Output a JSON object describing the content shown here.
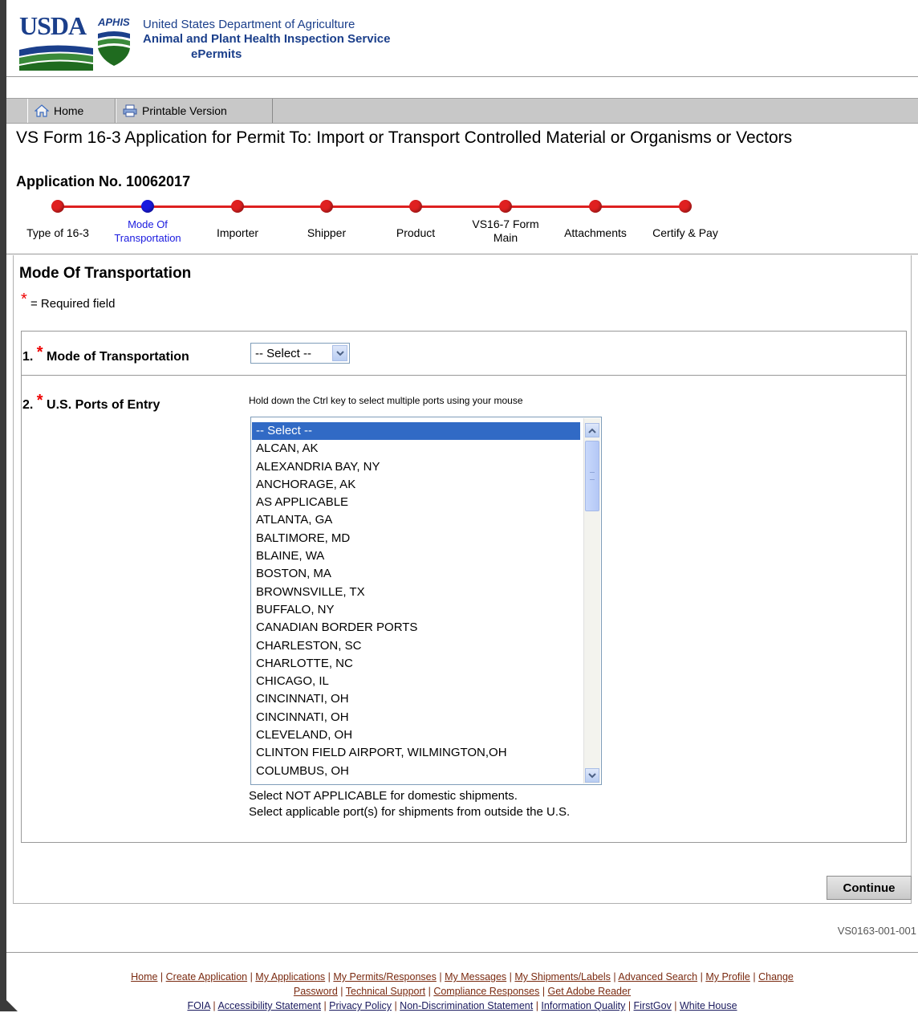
{
  "header": {
    "usda": "USDA",
    "aphis": "APHIS",
    "org_line1": "United States Department of Agriculture",
    "org_line2": "Animal and Plant Health Inspection Service",
    "org_line3": "ePermits"
  },
  "toolbar": {
    "home_label": "Home",
    "print_label": "Printable Version"
  },
  "form": {
    "title": "VS Form 16-3 Application for Permit To: Import or Transport Controlled Material or Organisms or Vectors",
    "application_no": "Application No. 10062017"
  },
  "progress": {
    "steps": [
      {
        "label": "Type of 16-3",
        "current": false
      },
      {
        "label": "Mode Of Transportation",
        "current": true
      },
      {
        "label": "Importer",
        "current": false
      },
      {
        "label": "Shipper",
        "current": false
      },
      {
        "label": "Product",
        "current": false
      },
      {
        "label": "VS16-7 Form Main",
        "current": false
      },
      {
        "label": "Attachments",
        "current": false
      },
      {
        "label": "Certify & Pay",
        "current": false
      }
    ]
  },
  "section": {
    "title": "Mode Of Transportation",
    "required_star": "*",
    "required_note": "= Required field"
  },
  "fields": {
    "q1_number": "1.",
    "q1_label": "Mode of Transportation",
    "q1_value": "-- Select --",
    "q2_number": "2.",
    "q2_label": "U.S. Ports of Entry",
    "ctrl_hint": "Hold down the Ctrl key to select multiple ports using your mouse",
    "ports": [
      "-- Select --",
      "ALCAN, AK",
      "ALEXANDRIA BAY, NY",
      "ANCHORAGE, AK",
      "AS APPLICABLE",
      "ATLANTA, GA",
      "BALTIMORE, MD",
      "BLAINE, WA",
      "BOSTON, MA",
      "BROWNSVILLE, TX",
      "BUFFALO, NY",
      "CANADIAN BORDER PORTS",
      "CHARLESTON, SC",
      "CHARLOTTE, NC",
      "CHICAGO, IL",
      "CINCINNATI, OH",
      "CINCINNATI, OH",
      "CLEVELAND, OH",
      "CLINTON FIELD AIRPORT, WILMINGTON,OH",
      "COLUMBUS, OH"
    ],
    "selected_port": "-- Select --",
    "note_line1": "Select NOT APPLICABLE for domestic shipments.",
    "note_line2": "Select applicable port(s) for shipments from outside the U.S."
  },
  "actions": {
    "continue_label": "Continue"
  },
  "page_code": "VS0163-001-001",
  "footer": {
    "line1": [
      "Home",
      "Create Application",
      "My Applications",
      "My Permits/Responses",
      "My Messages",
      "My Shipments/Labels",
      "Advanced Search",
      "My Profile",
      "Change"
    ],
    "line2": [
      "Password",
      "Technical Support",
      "Compliance Responses",
      "Get Adobe Reader"
    ],
    "line3": [
      "FOIA",
      "Accessibility Statement",
      "Privacy Policy",
      "Non-Discrimination Statement",
      "Information Quality",
      "FirstGov",
      "White House"
    ]
  },
  "colors": {
    "brand_blue": "#1b3f8b",
    "progress_red": "#e02020",
    "progress_current": "#1a1adf",
    "selection_blue": "#316ac5",
    "required_red": "#ee0000"
  }
}
